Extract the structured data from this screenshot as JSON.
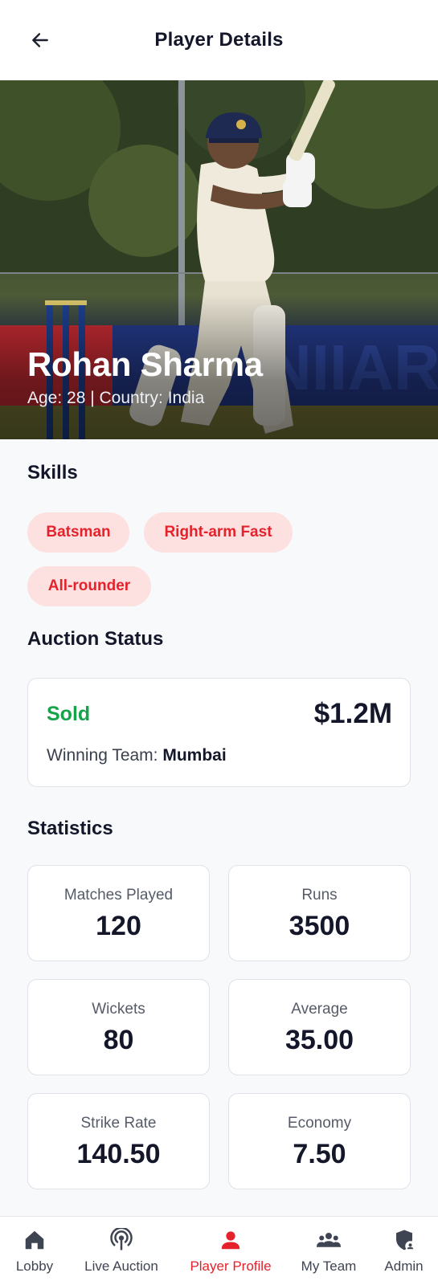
{
  "header": {
    "title": "Player Details",
    "back_icon": "arrow-left-icon"
  },
  "player": {
    "name": "Rohan Sharma",
    "meta": "Age: 28 | Country: India"
  },
  "skills": {
    "title": "Skills",
    "items": [
      "Batsman",
      "Right-arm Fast",
      "All-rounder"
    ]
  },
  "auction": {
    "title": "Auction Status",
    "status": "Sold",
    "price": "$1.2M",
    "winning_label": "Winning Team: ",
    "winning_team": "Mumbai"
  },
  "statistics": {
    "title": "Statistics",
    "items": [
      {
        "label": "Matches Played",
        "value": "120"
      },
      {
        "label": "Runs",
        "value": "3500"
      },
      {
        "label": "Wickets",
        "value": "80"
      },
      {
        "label": "Average",
        "value": "35.00"
      },
      {
        "label": "Strike Rate",
        "value": "140.50"
      },
      {
        "label": "Economy",
        "value": "7.50"
      }
    ]
  },
  "nav": {
    "items": [
      {
        "label": "Lobby",
        "icon": "home-icon"
      },
      {
        "label": "Live Auction",
        "icon": "broadcast-icon"
      },
      {
        "label": "Player Profile",
        "icon": "person-icon"
      },
      {
        "label": "My Team",
        "icon": "group-icon"
      },
      {
        "label": "Admin",
        "icon": "admin-shield-icon"
      }
    ],
    "active": "Player Profile"
  },
  "colors": {
    "accent": "#e5222b",
    "chip_bg": "#fde0e0",
    "sold": "#16a34a"
  }
}
